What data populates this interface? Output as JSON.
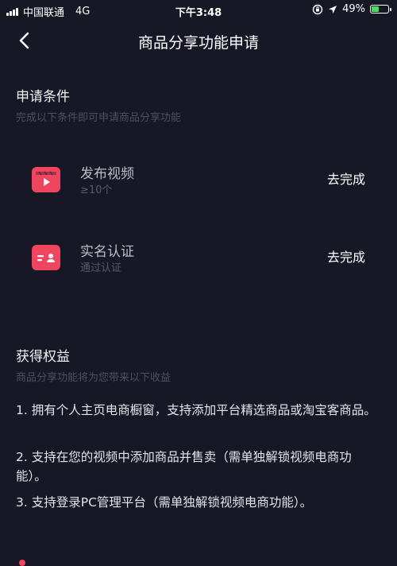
{
  "status": {
    "carrier": "中国联通",
    "network": "4G",
    "time": "下午3:48",
    "battery_percent": "49%",
    "battery_level": 0.49,
    "battery_color": "#4cd964",
    "icons": [
      "signal-icon",
      "lock-rotation-icon",
      "location-arrow-icon",
      "battery-icon"
    ]
  },
  "nav": {
    "title": "商品分享功能申请",
    "back_icon": "chevron-left-icon"
  },
  "conditions": {
    "title": "申请条件",
    "subtitle": "完成以下条件即可申请商品分享功能",
    "items": [
      {
        "title": "发布视频",
        "detail": "≥10个",
        "action": "去完成",
        "icon": "video-clapper-icon"
      },
      {
        "title": "实名认证",
        "detail": "通过认证",
        "action": "去完成",
        "icon": "id-card-icon"
      }
    ]
  },
  "benefits": {
    "title": "获得权益",
    "subtitle": "商品分享功能将为您带来以下收益",
    "items": [
      "1. 拥有个人主页电商橱窗，支持添加平台精选商品或淘宝客商品。",
      "2. 支持在您的视频中添加商品并售卖（需单独解锁视频电商功能）。",
      "3. 支持登录PC管理平台（需单独解锁视频电商功能）。"
    ]
  },
  "colors": {
    "background": "#171726",
    "accent": "#f0455e"
  }
}
